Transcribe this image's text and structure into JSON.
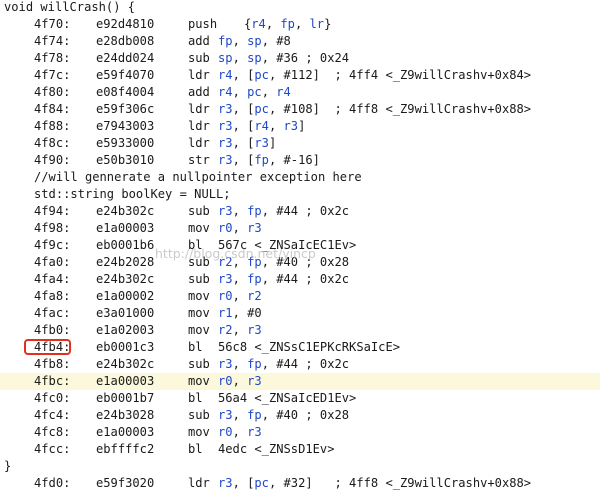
{
  "lines": [
    {
      "src": "void willCrash() {"
    },
    {
      "addr": "4f70:",
      "hex": "e92d4810",
      "op": "push",
      "opnd": "{r4, fp, lr}",
      "wide": true
    },
    {
      "addr": "4f74:",
      "hex": "e28db008",
      "op": "add",
      "opnd": "fp, sp, #8"
    },
    {
      "addr": "4f78:",
      "hex": "e24dd024",
      "op": "sub",
      "opnd": "sp, sp, #36 ; 0x24"
    },
    {
      "addr": "4f7c:",
      "hex": "e59f4070",
      "op": "ldr",
      "opnd": "r4, [pc, #112]  ; 4ff4 <_Z9willCrashv+0x84>"
    },
    {
      "addr": "4f80:",
      "hex": "e08f4004",
      "op": "add",
      "opnd": "r4, pc, r4"
    },
    {
      "addr": "4f84:",
      "hex": "e59f306c",
      "op": "ldr",
      "opnd": "r3, [pc, #108]  ; 4ff8 <_Z9willCrashv+0x88>"
    },
    {
      "addr": "4f88:",
      "hex": "e7943003",
      "op": "ldr",
      "opnd": "r3, [r4, r3]"
    },
    {
      "addr": "4f8c:",
      "hex": "e5933000",
      "op": "ldr",
      "opnd": "r3, [r3]"
    },
    {
      "addr": "4f90:",
      "hex": "e50b3010",
      "op": "str",
      "opnd": "r3, [fp, #-16]"
    },
    {
      "src": "//will gennerate a nullpointer exception here",
      "indent": true
    },
    {
      "src": "std::string boolKey = NULL;",
      "indent": true
    },
    {
      "addr": "4f94:",
      "hex": "e24b302c",
      "op": "sub",
      "opnd": "r3, fp, #44 ; 0x2c"
    },
    {
      "addr": "4f98:",
      "hex": "e1a00003",
      "op": "mov",
      "opnd": "r0, r3"
    },
    {
      "addr": "4f9c:",
      "hex": "eb0001b6",
      "op": "bl",
      "opnd": "567c <_ZNSaIcEC1Ev>"
    },
    {
      "addr": "4fa0:",
      "hex": "e24b2028",
      "op": "sub",
      "opnd": "r2, fp, #40 ; 0x28"
    },
    {
      "addr": "4fa4:",
      "hex": "e24b302c",
      "op": "sub",
      "opnd": "r3, fp, #44 ; 0x2c"
    },
    {
      "addr": "4fa8:",
      "hex": "e1a00002",
      "op": "mov",
      "opnd": "r0, r2"
    },
    {
      "addr": "4fac:",
      "hex": "e3a01000",
      "op": "mov",
      "opnd": "r1, #0"
    },
    {
      "addr": "4fb0:",
      "hex": "e1a02003",
      "op": "mov",
      "opnd": "r2, r3"
    },
    {
      "addr": "4fb4:",
      "hex": "eb0001c3",
      "op": "bl",
      "opnd": "56c8 <_ZNSsC1EPKcRKSaIcE>"
    },
    {
      "addr": "4fb8:",
      "hex": "e24b302c",
      "op": "sub",
      "opnd": "r3, fp, #44 ; 0x2c"
    },
    {
      "addr": "4fbc:",
      "hex": "e1a00003",
      "op": "mov",
      "opnd": "r0, r3",
      "highlight": true
    },
    {
      "addr": "4fc0:",
      "hex": "eb0001b7",
      "op": "bl",
      "opnd": "56a4 <_ZNSaIcED1Ev>"
    },
    {
      "addr": "4fc4:",
      "hex": "e24b3028",
      "op": "sub",
      "opnd": "r3, fp, #40 ; 0x28"
    },
    {
      "addr": "4fc8:",
      "hex": "e1a00003",
      "op": "mov",
      "opnd": "r0, r3"
    },
    {
      "addr": "4fcc:",
      "hex": "ebffffc2",
      "op": "bl",
      "opnd": "4edc <_ZNSsD1Ev>"
    },
    {
      "src": "}"
    },
    {
      "addr": "4fd0:",
      "hex": "e59f3020",
      "op": "ldr",
      "opnd": "r3, [pc, #32]   ; 4ff8 <_Z9willCrashv+0x88>"
    }
  ],
  "watermark": "http://blog.csdn.net/yincp",
  "marker_line": 20,
  "colors": {
    "register": "#1f47c8",
    "highlight": "#fcf8dc",
    "marker": "#e0301e"
  }
}
